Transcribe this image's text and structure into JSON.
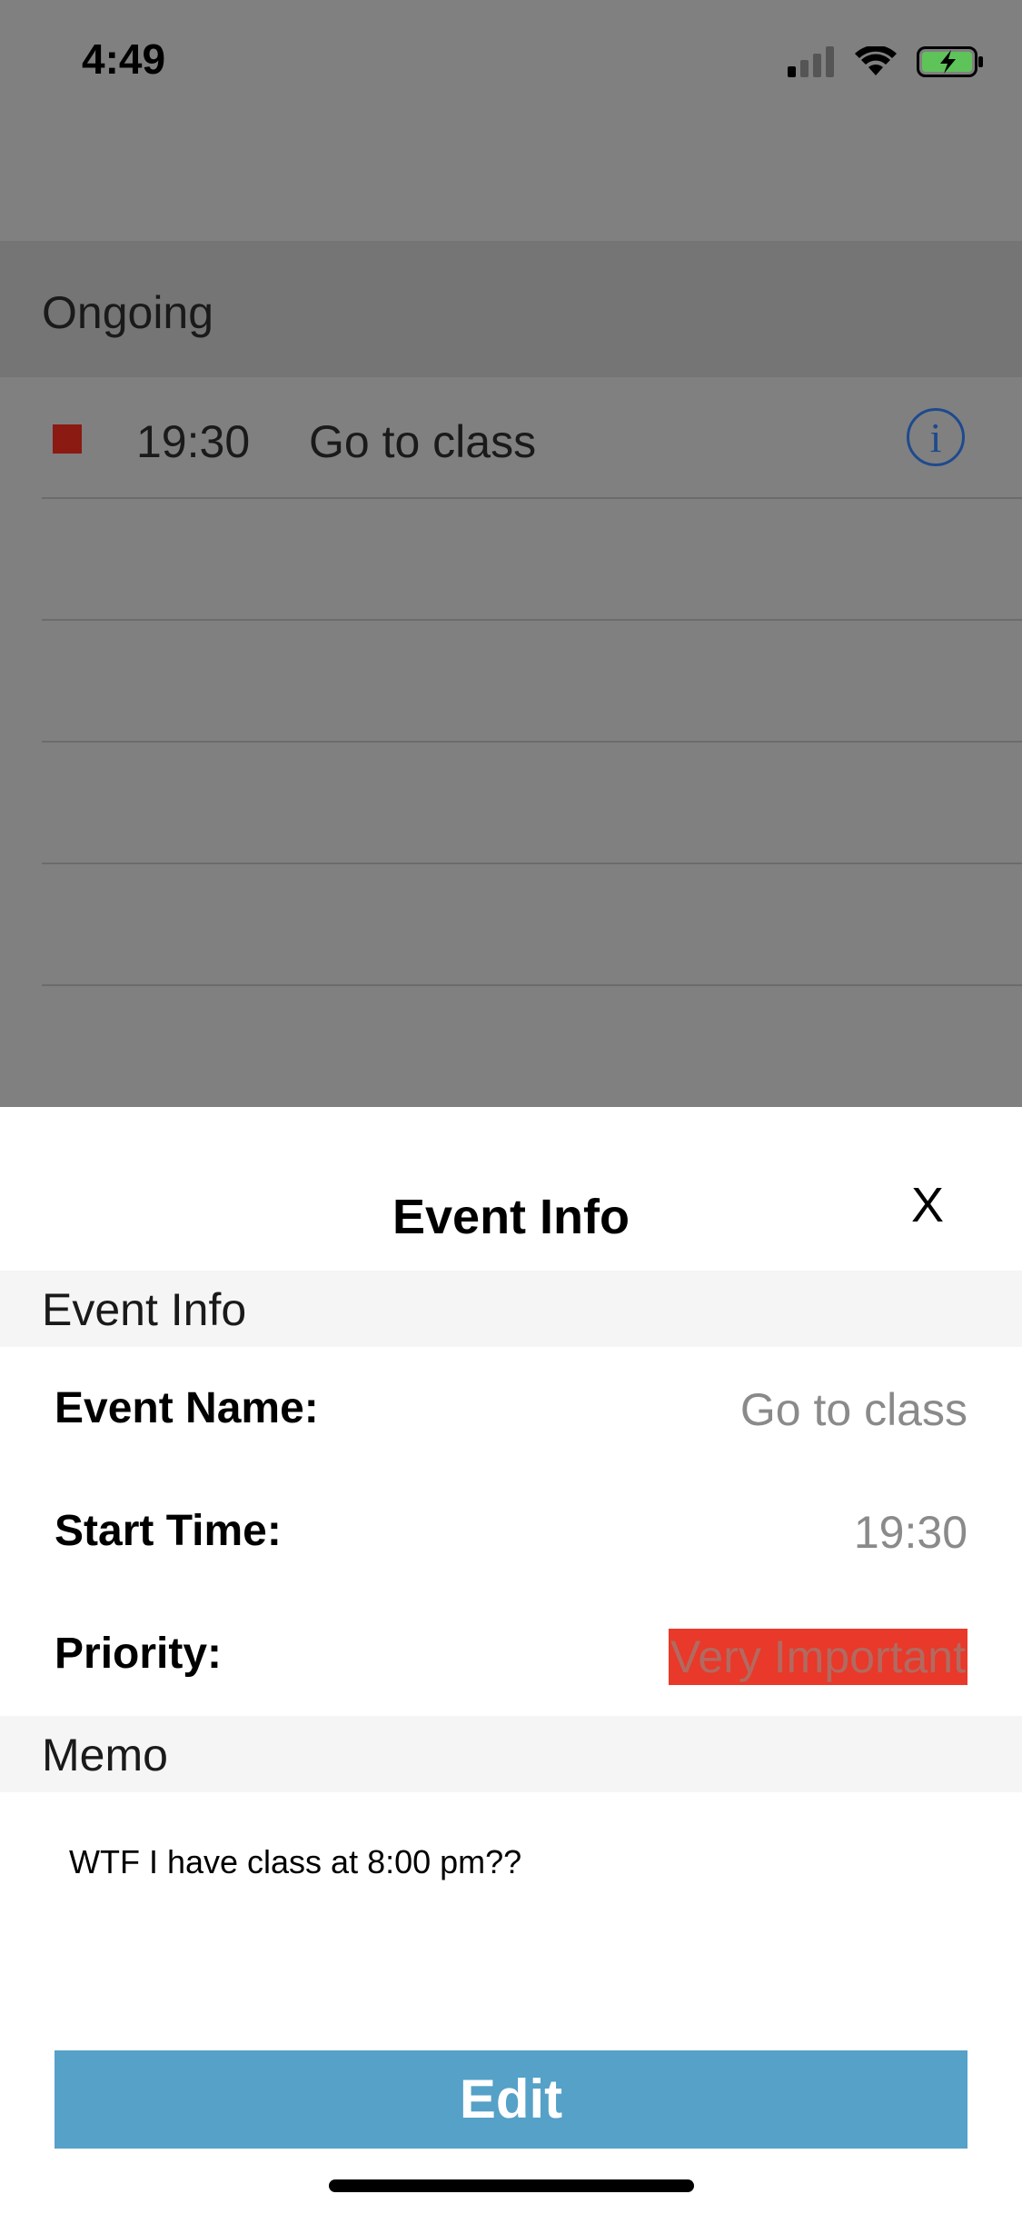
{
  "status_bar": {
    "time": "4:49",
    "icons": [
      "cellular-signal-icon",
      "wifi-icon",
      "battery-charging-icon"
    ]
  },
  "background": {
    "section_title": "Ongoing",
    "events": [
      {
        "time": "19:30",
        "name": "Go to class",
        "priority_color": "#8a1a12"
      }
    ],
    "info_icon_glyph": "i"
  },
  "modal": {
    "title": "Event Info",
    "close_label": "X",
    "event_info_header": "Event Info",
    "fields": {
      "event_name_label": "Event Name:",
      "event_name_value": "Go to class",
      "start_time_label": "Start Time:",
      "start_time_value": "19:30",
      "priority_label": "Priority:",
      "priority_value": "Very Important"
    },
    "memo_header": "Memo",
    "memo_text": "WTF I have class at 8:00 pm??",
    "edit_label": "Edit"
  },
  "colors": {
    "overlay": "#808080",
    "priority_highlight": "#e8392a",
    "edit_button": "#55a1c8",
    "info_icon": "#1e4a8e"
  }
}
